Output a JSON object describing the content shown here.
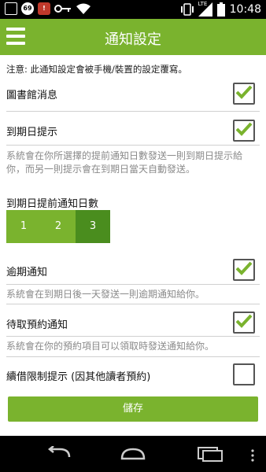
{
  "status_bar": {
    "time": "10:48",
    "badge_69": "69",
    "badge_red": "!",
    "network": "LTE"
  },
  "app_bar": {
    "title": "通知設定"
  },
  "notice": "注意: 此通知設定會被手機/裝置的設定覆寫。",
  "settings": [
    {
      "label": "圖書館消息",
      "checked": true
    },
    {
      "label": "到期日提示",
      "checked": true,
      "desc": "系統會在你所選擇的提前通知日數發送一則到期日提示給你，而另一則提示會在到期日當天自動發送。"
    },
    {
      "label": "逾期通知",
      "checked": true,
      "desc": "系統會在到期日後一天發送一則逾期通知給你。"
    },
    {
      "label": "待取預約通知",
      "checked": true,
      "desc": "系統會在你的預約項目可以領取時發送通知給你。"
    },
    {
      "label": "續借限制提示 (因其他讀者預約)",
      "checked": false
    }
  ],
  "days_selector": {
    "label": "到期日提前通知日數",
    "options": [
      "1",
      "2",
      "3"
    ],
    "selected": "3"
  },
  "save_label": "儲存",
  "colors": {
    "accent": "#7ab32e",
    "accent_selected": "#4a8d1e"
  }
}
